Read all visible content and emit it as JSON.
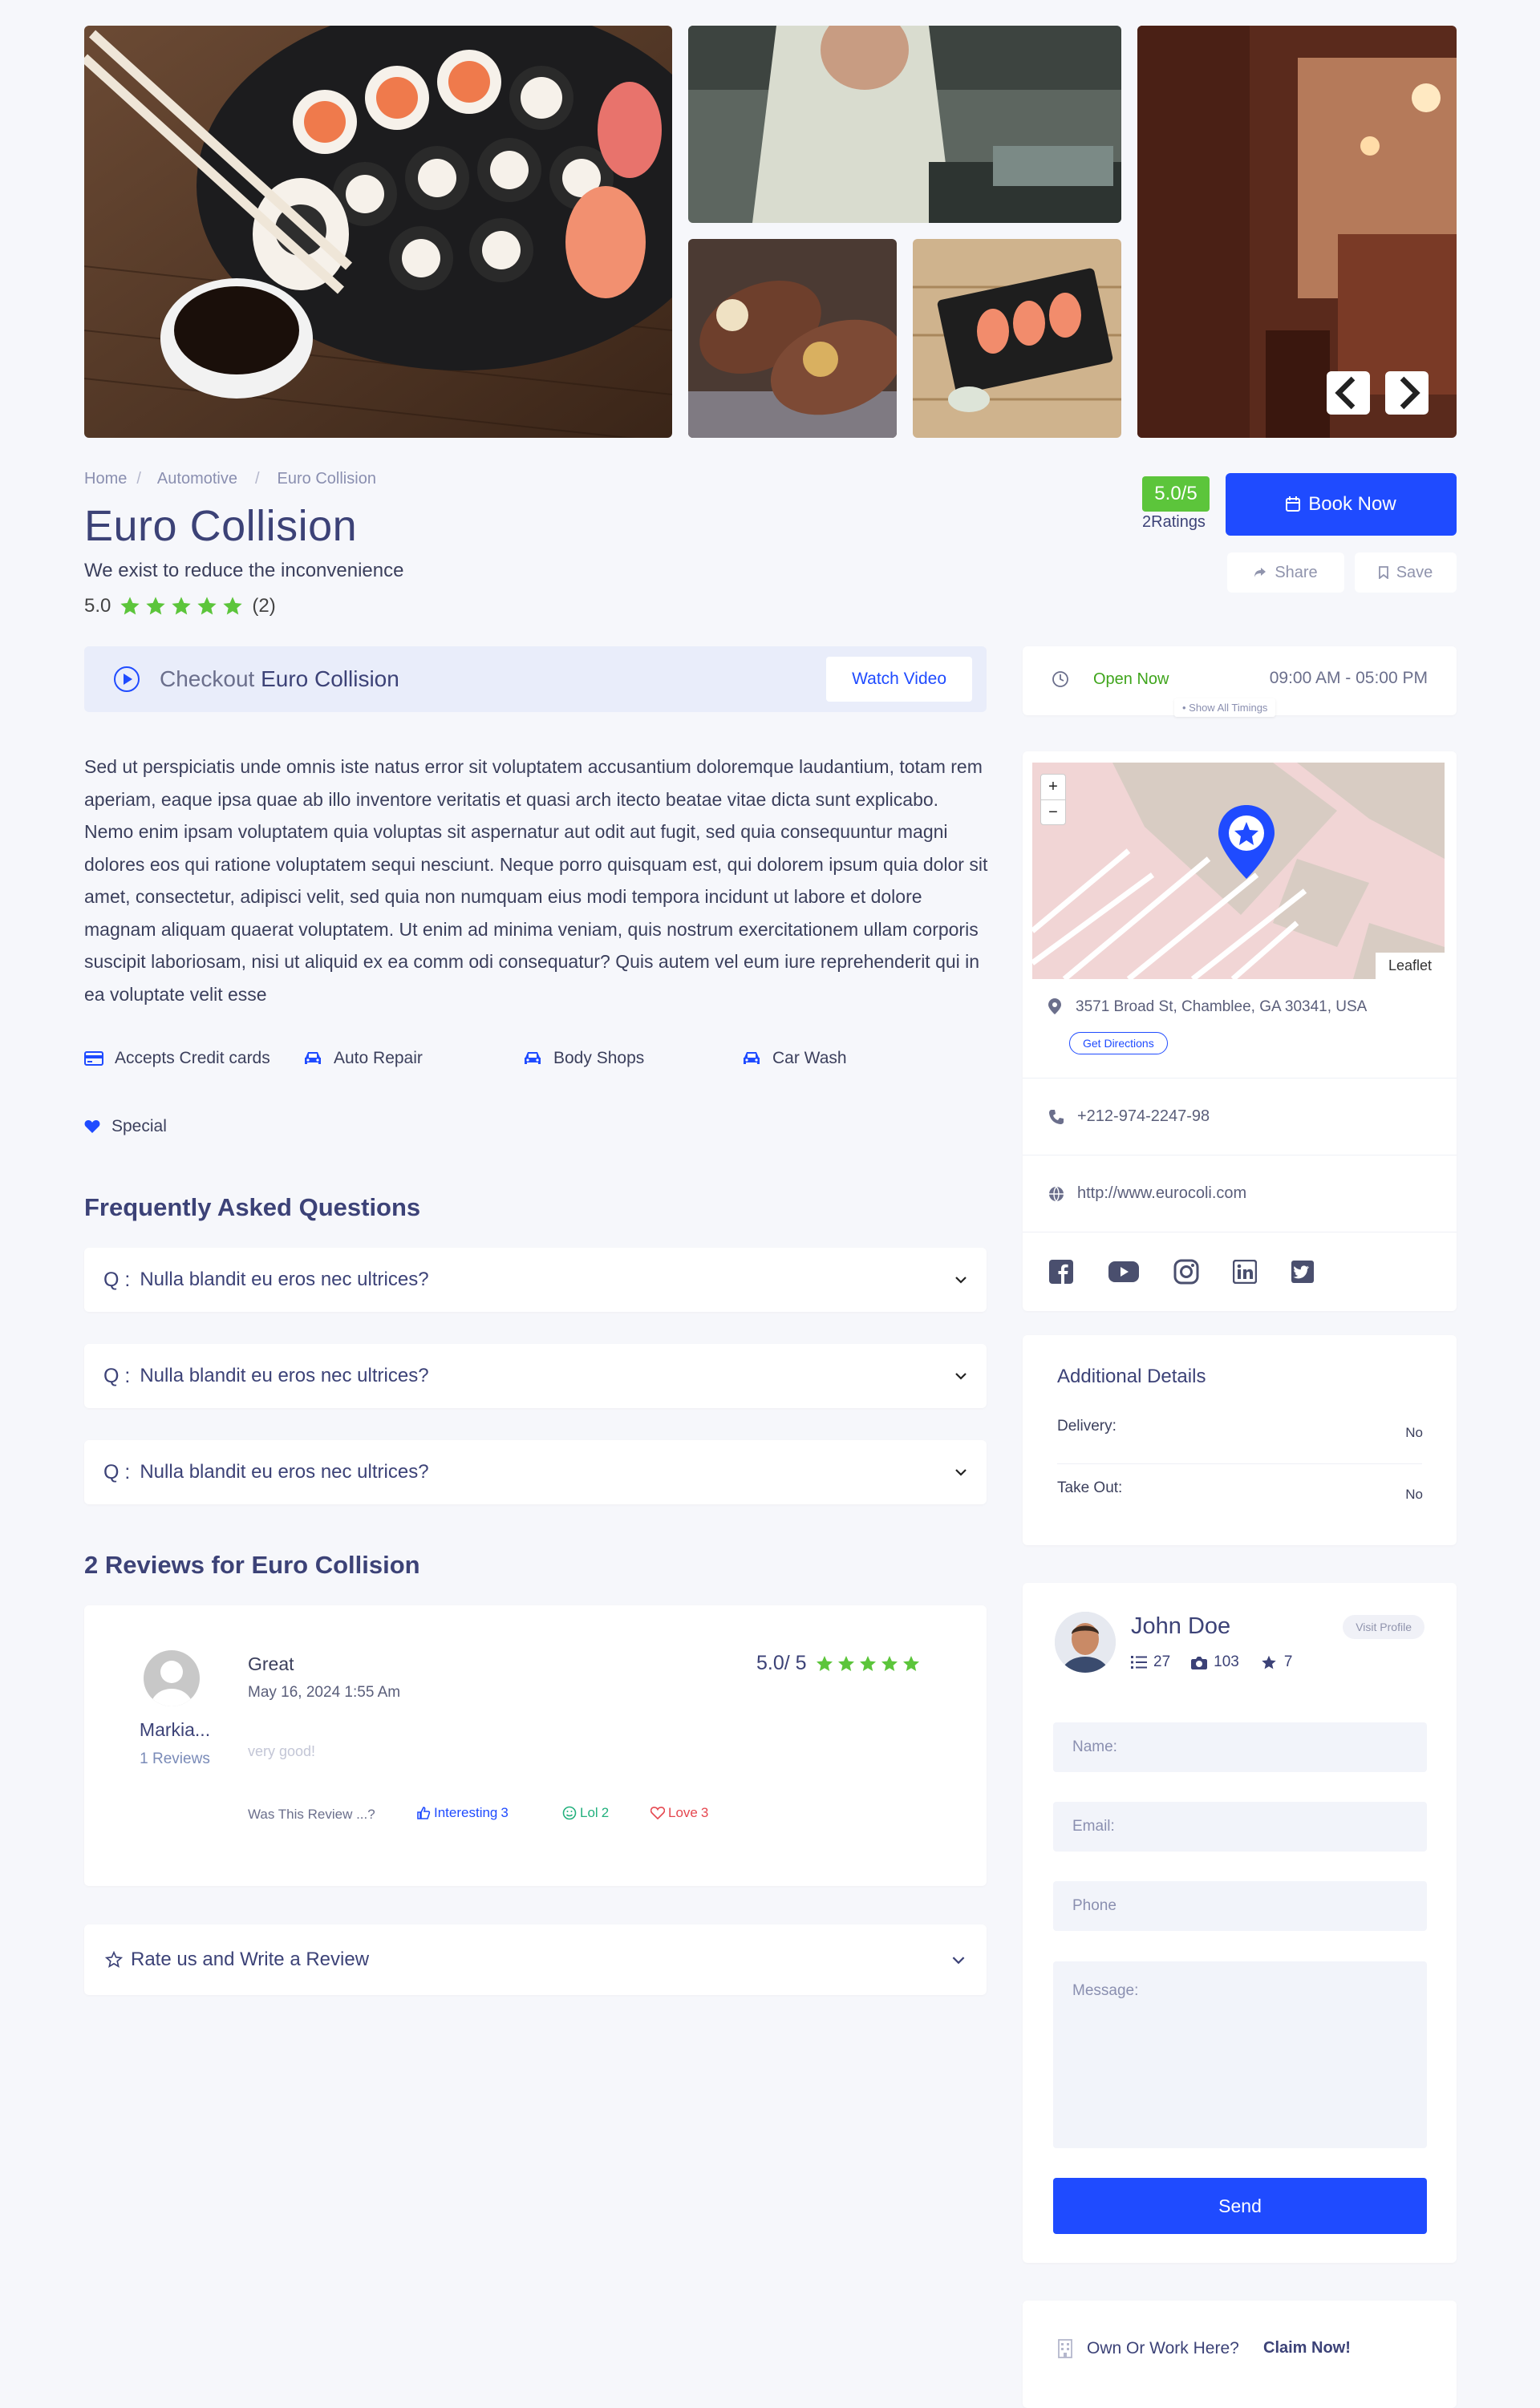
{
  "gallery": {
    "prev_icon": "chevron-left-icon",
    "next_icon": "chevron-right-icon"
  },
  "breadcrumb": {
    "items": [
      "Home",
      "Automotive",
      "Euro Collision"
    ],
    "separator": "/"
  },
  "listing": {
    "title": "Euro Collision",
    "tagline": "We exist to reduce the inconvenience",
    "rating_value": "5.0",
    "rating_count": "(2)",
    "stars": 5,
    "score_badge": "5.0/5",
    "ratings_label": "2Ratings",
    "book_label": "Book Now",
    "share_label": "Share",
    "save_label": "Save"
  },
  "video": {
    "prefix": "Checkout",
    "name": "Euro Collision",
    "button": "Watch Video"
  },
  "description": "Sed ut perspiciatis unde omnis iste natus error sit voluptatem accusantium doloremque laudantium, totam rem aperiam, eaque ipsa quae ab illo inventore veritatis et quasi arch itecto beatae vitae dicta sunt explicabo. Nemo enim ipsam voluptatem quia voluptas sit aspernatur aut odit aut fugit, sed quia consequuntur magni dolores eos qui ratione voluptatem sequi nesciunt. Neque porro quisquam est, qui dolorem ipsum quia dolor sit amet, consectetur, adipisci velit, sed quia non numquam eius modi tempora incidunt ut labore et dolore magnam aliquam quaerat voluptatem. Ut enim ad minima veniam, quis nostrum exercitationem ullam corporis suscipit laboriosam, nisi ut aliquid ex ea comm odi consequatur? Quis autem vel eum iure reprehenderit qui in ea voluptate velit esse",
  "features": [
    {
      "label": "Accepts Credit cards",
      "icon": "credit-card-icon"
    },
    {
      "label": "Auto Repair",
      "icon": "car-icon"
    },
    {
      "label": "Body Shops",
      "icon": "car-icon"
    },
    {
      "label": "Car Wash",
      "icon": "car-icon"
    },
    {
      "label": "Special",
      "icon": "heart-icon"
    }
  ],
  "faq": {
    "title": "Frequently Asked Questions",
    "q_label": "Q :",
    "items": [
      "Nulla blandit eu eros nec ultrices?",
      "Nulla blandit eu eros nec ultrices?",
      "Nulla blandit eu eros nec ultrices?"
    ]
  },
  "reviews": {
    "title": "2 Reviews for Euro Collision",
    "items": [
      {
        "author": "Markia...",
        "author_reviews": "1 Reviews",
        "headline": "Great",
        "date": "May 16, 2024 1:55 Am",
        "score": "5.0/ 5",
        "body": "very good!",
        "was_this": "Was This Review ...?",
        "interesting": "Interesting",
        "interesting_count": "3",
        "lol": "Lol",
        "lol_count": "2",
        "love": "Love",
        "love_count": "3"
      }
    ],
    "write_label": "Rate us and Write a Review"
  },
  "hours": {
    "status": "Open Now",
    "time": "09:00 AM - 05:00 PM",
    "show_all": "Show All Timings"
  },
  "contact": {
    "map_attribution": "Leaflet",
    "zoom_in": "+",
    "zoom_out": "−",
    "address": "3571 Broad St, Chamblee, GA 30341, USA",
    "directions": "Get Directions",
    "phone": "+212-974-2247-98",
    "website": "http://www.eurocoli.com",
    "socials": [
      "facebook-icon",
      "youtube-icon",
      "instagram-icon",
      "linkedin-icon",
      "twitter-icon"
    ]
  },
  "additional": {
    "title": "Additional Details",
    "rows": [
      {
        "label": "Delivery:",
        "value": "No"
      },
      {
        "label": "Take Out:",
        "value": "No"
      }
    ]
  },
  "owner": {
    "name": "John Doe",
    "visit": "Visit Profile",
    "listings": "27",
    "photos": "103",
    "reviews": "7",
    "fields": {
      "name": "Name:",
      "email": "Email:",
      "phone": "Phone",
      "message": "Message:"
    },
    "send": "Send"
  },
  "claim": {
    "text": "Own Or Work Here?",
    "link": "Claim Now!"
  },
  "colors": {
    "primary": "#1f4bff",
    "heading": "#3c4277",
    "star": "#5cc53b",
    "page_bg": "#f6f7fb"
  }
}
